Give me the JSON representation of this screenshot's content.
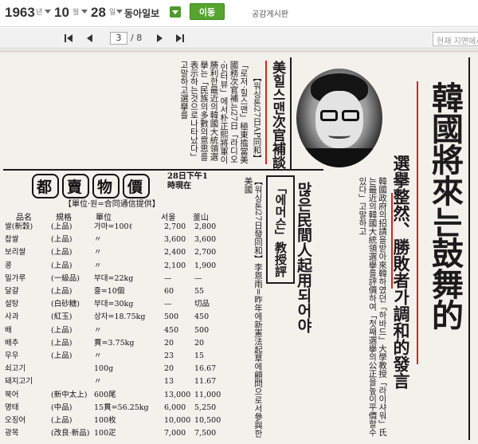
{
  "date": {
    "year": "1963",
    "year_unit": "년",
    "month": "10",
    "month_unit": "월",
    "day": "28",
    "day_unit": "일"
  },
  "paper": {
    "name": "동아일보"
  },
  "go_label": "이동",
  "board_link": "공감게시판",
  "pager": {
    "current": "3",
    "total": "/ 8"
  },
  "search": {
    "placeholder": "현재 지면에서"
  },
  "article_main": {
    "headline": "韓國將來는鼓舞的",
    "subhead": "選擧整然、勝敗者가調和的發言",
    "body": "韓國政府의招請을받아來韓하였던「하바드」大學教授「라이샤워」氏는最近의韓國大統領選擧를評價하여「첫째選擧의公正을높이平價할수있다」고말하고"
  },
  "article_green": {
    "title": "美힐스맨次官補談",
    "dateline": "【워싱톤27日AP同和】",
    "body": "「로저·힐스맨」極東擔當美國務次官補는27日「라디오·인터뷰」에서朴正熙將軍이勝利한最近의韓國大統領選擧는「民族의多數의意思를表示하는것으로나타났다」고말하고選擧를"
  },
  "article_civil": {
    "title": "많은民間人起用되어야",
    "subtitle": "「에머슨」教授評",
    "body": "【워싱톤27日發同和】李恩雨=昨年에新憲法起草에顧問으로서參與한美國"
  },
  "prices": {
    "title": [
      "都",
      "賣",
      "物",
      "價"
    ],
    "time": "28日下午1時現在",
    "unit_note": "【單位·원=合同通信提供】",
    "headers": [
      "品名",
      "規格",
      "單位",
      "서울",
      "釜山"
    ],
    "rows": [
      [
        "쌀(新穀)",
        "(上品)",
        "가마=100ℓ",
        "2,700",
        "2,800"
      ],
      [
        "찹쌀",
        "(上品)",
        "〃",
        "3,600",
        "3,600"
      ],
      [
        "보리쌀",
        "(上品)",
        "〃",
        "2,400",
        "2,700"
      ],
      [
        "콩",
        "(上品)",
        "〃",
        "2,100",
        "1,900"
      ],
      [
        "밀가루",
        "(一級品)",
        "부대=22kg",
        "—",
        "—"
      ],
      [
        "달걀",
        "(上品)",
        "줄=10個",
        "60",
        "55"
      ],
      [
        "설탕",
        "(白砂糖)",
        "부대=30kg",
        "—",
        "切品"
      ],
      [
        "사과",
        "(紅玉)",
        "상자=18.75kg",
        "500",
        "450"
      ],
      [
        "배",
        "(上品)",
        "〃",
        "450",
        "500"
      ],
      [
        "배추",
        "(上品)",
        "貫=3.75kg",
        "20",
        "20"
      ],
      [
        "무우",
        "(上品)",
        "〃",
        "23",
        "15"
      ],
      [
        "쇠고기",
        "",
        "100g",
        "20",
        "16.67"
      ],
      [
        "돼지고기",
        "",
        "〃",
        "13",
        "11.67"
      ],
      [
        "북어",
        "(新中太上)",
        "600尾",
        "13,000",
        "11,000"
      ],
      [
        "명태",
        "(中品)",
        "15貫=56.25kg",
        "6,000",
        "5,250"
      ],
      [
        "오징어",
        "(上品)",
        "100枚",
        "10,000",
        "10,500"
      ],
      [
        "광목",
        "(改良·新品)",
        "100疋",
        "7,000",
        "7,500"
      ]
    ]
  }
}
